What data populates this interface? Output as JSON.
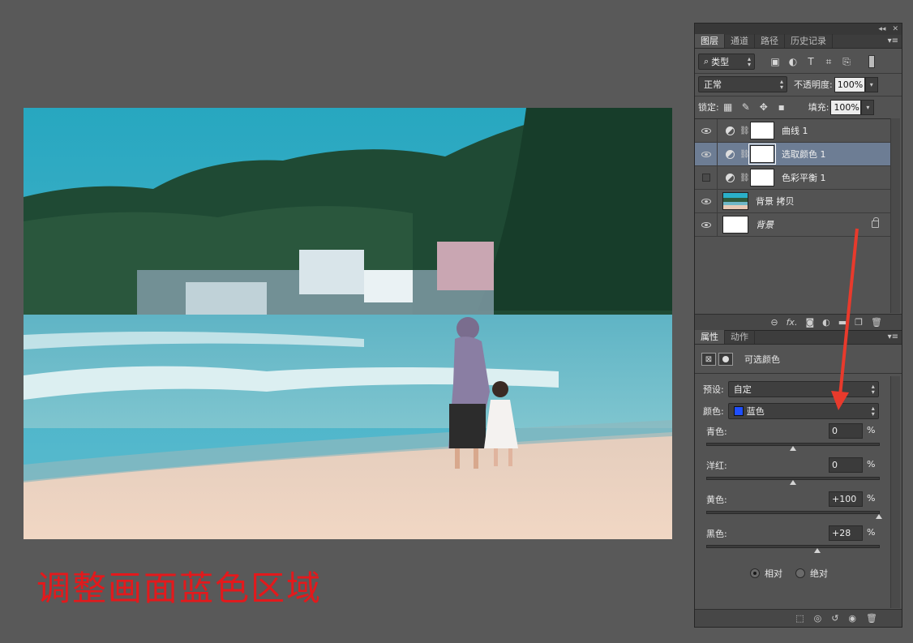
{
  "caption": "调整画面蓝色区域",
  "layers_panel": {
    "tabs": [
      "图层",
      "通道",
      "路径",
      "历史记录"
    ],
    "filter_kind": "类型",
    "blend_mode": "正常",
    "opacity_label": "不透明度:",
    "opacity_value": "100%",
    "lock_label": "锁定:",
    "fill_label": "填充:",
    "fill_value": "100%",
    "layers": [
      {
        "name": "曲线 1",
        "visible": true,
        "type": "adjustment",
        "selected": false
      },
      {
        "name": "选取颜色 1",
        "visible": true,
        "type": "adjustment",
        "selected": true
      },
      {
        "name": "色彩平衡 1",
        "visible": false,
        "type": "adjustment",
        "selected": false
      },
      {
        "name": "背景 拷贝",
        "visible": true,
        "type": "image",
        "selected": false
      },
      {
        "name": "背景",
        "visible": true,
        "type": "background",
        "selected": false,
        "locked": true
      }
    ],
    "bottom_icons": [
      "link-icon",
      "fx-icon",
      "mask-icon",
      "adjustment-icon",
      "folder-icon",
      "new-layer-icon",
      "trash-icon"
    ]
  },
  "properties_panel": {
    "tabs": [
      "属性",
      "动作"
    ],
    "title": "可选颜色",
    "preset_label": "预设:",
    "preset_value": "自定",
    "color_label": "颜色:",
    "color_value": "蓝色",
    "color_swatch": "#1f4fff",
    "sliders": [
      {
        "label": "青色:",
        "value": "0",
        "percent": 50
      },
      {
        "label": "洋红:",
        "value": "0",
        "percent": 50
      },
      {
        "label": "黄色:",
        "value": "+100",
        "percent": 100
      },
      {
        "label": "黑色:",
        "value": "+28",
        "percent": 64
      }
    ],
    "pct_sign": "%",
    "mode_relative": "相对",
    "mode_absolute": "绝对",
    "mode_selected": "relative"
  },
  "colors": {
    "annotation_red": "#e83a2c",
    "selection_blue": "#6d7d94"
  }
}
